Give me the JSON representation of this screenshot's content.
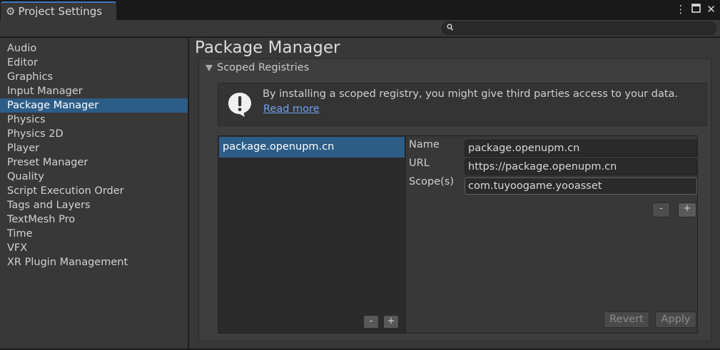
{
  "window": {
    "tab_title": "Project Settings",
    "icons": [
      "kebab-menu-icon",
      "maximize-icon",
      "close-icon"
    ]
  },
  "search": {
    "placeholder": "",
    "value": ""
  },
  "sidebar": {
    "items": [
      {
        "label": "Audio"
      },
      {
        "label": "Editor"
      },
      {
        "label": "Graphics"
      },
      {
        "label": "Input Manager"
      },
      {
        "label": "Package Manager",
        "selected": true
      },
      {
        "label": "Physics"
      },
      {
        "label": "Physics 2D"
      },
      {
        "label": "Player"
      },
      {
        "label": "Preset Manager"
      },
      {
        "label": "Quality"
      },
      {
        "label": "Script Execution Order"
      },
      {
        "label": "Tags and Layers"
      },
      {
        "label": "TextMesh Pro"
      },
      {
        "label": "Time"
      },
      {
        "label": "VFX"
      },
      {
        "label": "XR Plugin Management"
      }
    ]
  },
  "main": {
    "title": "Package Manager",
    "section": {
      "title": "Scoped Registries",
      "help": {
        "text": "By installing a scoped registry, you might give third parties access to your data.",
        "link": "Read more"
      },
      "registries": [
        {
          "name": "package.openupm.cn"
        }
      ],
      "list_buttons": {
        "remove": "-",
        "add": "+"
      },
      "details": {
        "name_label": "Name",
        "name_value": "package.openupm.cn",
        "url_label": "URL",
        "url_value": "https://package.openupm.cn",
        "scopes_label": "Scope(s)",
        "scopes_value": "com.tuyoogame.yooasset",
        "scope_remove": "-",
        "scope_add": "+",
        "revert_label": "Revert",
        "apply_label": "Apply"
      }
    }
  },
  "colors": {
    "selection": "#2c5d87",
    "link": "#70a3ec",
    "panel": "#383838",
    "tab_accent": "#3a79bb"
  }
}
